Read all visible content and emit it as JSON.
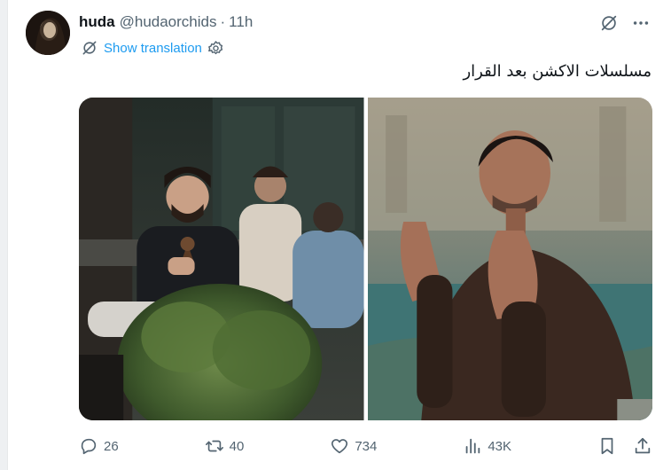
{
  "tweet": {
    "display_name": "huda",
    "handle": "@hudaorchids",
    "separator": "·",
    "time": "11h",
    "show_translation": "Show translation",
    "text": "مسلسلات الاكشن بعد القرار"
  },
  "actions": {
    "replies": "26",
    "reposts": "40",
    "likes": "734",
    "views": "43K"
  },
  "icons": {
    "grok": "grok-icon",
    "more": "more-icon",
    "translate": "translate-icon",
    "settings": "gear-icon",
    "reply": "reply-icon",
    "repost": "repost-icon",
    "like": "heart-icon",
    "views": "views-icon",
    "bookmark": "bookmark-icon",
    "share": "share-icon"
  },
  "colors": {
    "accent": "#1d9bf0",
    "muted": "#536471",
    "text": "#0f1419"
  }
}
